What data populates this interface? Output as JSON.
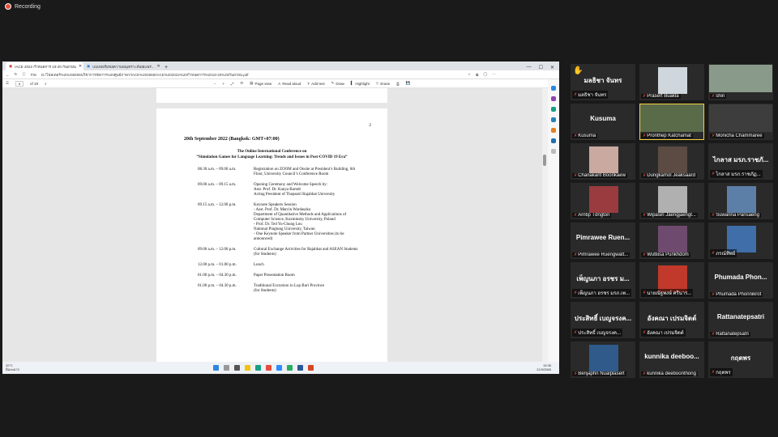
{
  "recording_label": "Recording",
  "browser": {
    "tabs": [
      {
        "label": "IACE 2022 กำหนดการ 19-20 กันยายน",
        "active": true
      },
      {
        "label": "แบบฟอร์มขอความอนุเคราะห์เผยแพร่...",
        "active": false
      }
    ],
    "file_label": "File",
    "url": "D:/โฟลเดอร์%20USB/สอนวิชาการจัดการ%20ศูนย์ภาษา/IACE%202565/IACE%202022%20กำหนดการ%2019-20%20กันยายน.pdf",
    "page_current": "8",
    "page_total": "of 19",
    "tools": [
      "Page view",
      "Read aloud",
      "Add text",
      "Draw",
      "Highlight",
      "Erase"
    ]
  },
  "pdf": {
    "page_number": "2",
    "date_line": "20th September 2022 (Bangkok: GMT+07:00)",
    "conference_line1": "The Online International Conference on",
    "conference_line2": "“Simulation Games for Language Learning: Trends and Issues in Post-COVID 19 Era”",
    "schedule": [
      {
        "time": "08.30 a.m. – 09.00 a.m.",
        "desc": "Registration on ZOOM and Onsite at President’s Building, 6th Floor, University Council’s Conference Room"
      },
      {
        "time": "09.00 a.m. – 09.15 a.m.",
        "desc": "Opening Ceremony and Welcome Speech by:\nAsst. Prof. Dr. Kanya Barndt\nActing President of Thepsatri Rajabhat University"
      },
      {
        "time": "09.15 a.m. – 12.00 p.m.",
        "desc": "Keynote Speakers Session\n- Asst. Prof. Dr. Marcin Wardaszko\nDepartment of Quantitative Methods and Applications of Computer Science, Kozminsky University, Poland\n- Prof. Dr. Ted Yu-Chung Lou\nNational Pingtung University, Taiwan\n- One Keynote Speaker from Partner Universities (to be announced)"
      },
      {
        "time": "09.00 a.m. – 12.00 p.m.",
        "desc": "Cultural Exchange Activities for Rajabhat and ASEAN Students (for Students)"
      },
      {
        "time": "12.00 p.m. – 01.00 p.m.",
        "desc": "Lunch"
      },
      {
        "time": "01.00 p.m. – 04.30 p.m.",
        "desc": "Paper Presentation Room"
      },
      {
        "time": "01.00 p.m. – 04.30 p.m.",
        "desc": "Traditional Excursion in Lop Buri Province\n(for Students)"
      }
    ]
  },
  "taskbar": {
    "temperature": "32°C",
    "weather": "มีเมฆมาก",
    "time": "15:36",
    "date": "21/9/2565"
  },
  "participants": [
    {
      "name": "มลธิชา จันทร",
      "big": "มลธิชา จันทร",
      "video": false,
      "hand": true
    },
    {
      "name": "Prasert Buakla",
      "big": "",
      "video": true,
      "color": "#cfd6dc"
    },
    {
      "name": "shin",
      "big": "",
      "video": true,
      "color": "#8a9a8a"
    },
    {
      "name": "Kusuma",
      "big": "Kusuma",
      "video": false
    },
    {
      "name": "Pronthep Katchamat",
      "big": "",
      "video": true,
      "color": "#5a6b4a",
      "speaking": true
    },
    {
      "name": "Monicha Chammaree",
      "big": "",
      "video": true,
      "color": "#3d3d3d"
    },
    {
      "name": "Chanakant Boonkaew",
      "big": "",
      "video": true,
      "color": "#c9a9a0"
    },
    {
      "name": "Dungkamol Jeaksaard",
      "big": "",
      "video": true,
      "color": "#5b4b43"
    },
    {
      "name": "ไกลาส มรภ.ราชภัฏ...",
      "big": "ไกลาส มรภ.ราชภั...",
      "video": false
    },
    {
      "name": "Arntip Tdngton",
      "big": "",
      "video": true,
      "color": "#9a3b40"
    },
    {
      "name": "Wipasiri Jaengjaengt...",
      "big": "",
      "video": true,
      "color": "#b0b0b0"
    },
    {
      "name": "Suwanna Pansaeng",
      "big": "",
      "video": true,
      "color": "#5c7fa8"
    },
    {
      "name": "Pimrawee Ruengwatt...",
      "big": "Pimrawee Ruen...",
      "video": false
    },
    {
      "name": "Wuttiisa Punkhdom",
      "big": "",
      "video": true,
      "color": "#6e4b6e"
    },
    {
      "name": "ภรณ์ทิพย์",
      "big": "",
      "video": true,
      "color": "#3f6ea8"
    },
    {
      "name": "เพ็ญนภา อรชร มรภ.เพ...",
      "big": "เพ็ญนภา อรชร ม...",
      "video": false
    },
    {
      "name": "นายณัฐพงษ์ ศรีนาร...",
      "big": "",
      "video": true,
      "color": "#c0392b"
    },
    {
      "name": "Phumada Phonnikrot",
      "big": "Phumada Phon...",
      "video": false
    },
    {
      "name": "ประสิทธิ์ เบญจรงค...",
      "big": "ประสิทธิ์ เบญจรงค...",
      "video": false
    },
    {
      "name": "อังคณา เปรมจิตต์",
      "big": "อังคณา เปรมจิตต์",
      "video": false
    },
    {
      "name": "Rattanatepsatri",
      "big": "Rattanatepsatri",
      "video": false
    },
    {
      "name": "Benjaphn Nualplasert",
      "big": "",
      "video": true,
      "color": "#2f5a8a"
    },
    {
      "name": "kunnika deeboonthong",
      "big": "kunnika deeboo...",
      "video": false
    },
    {
      "name": "กฤตพร",
      "big": "กฤตพร",
      "video": false
    }
  ]
}
